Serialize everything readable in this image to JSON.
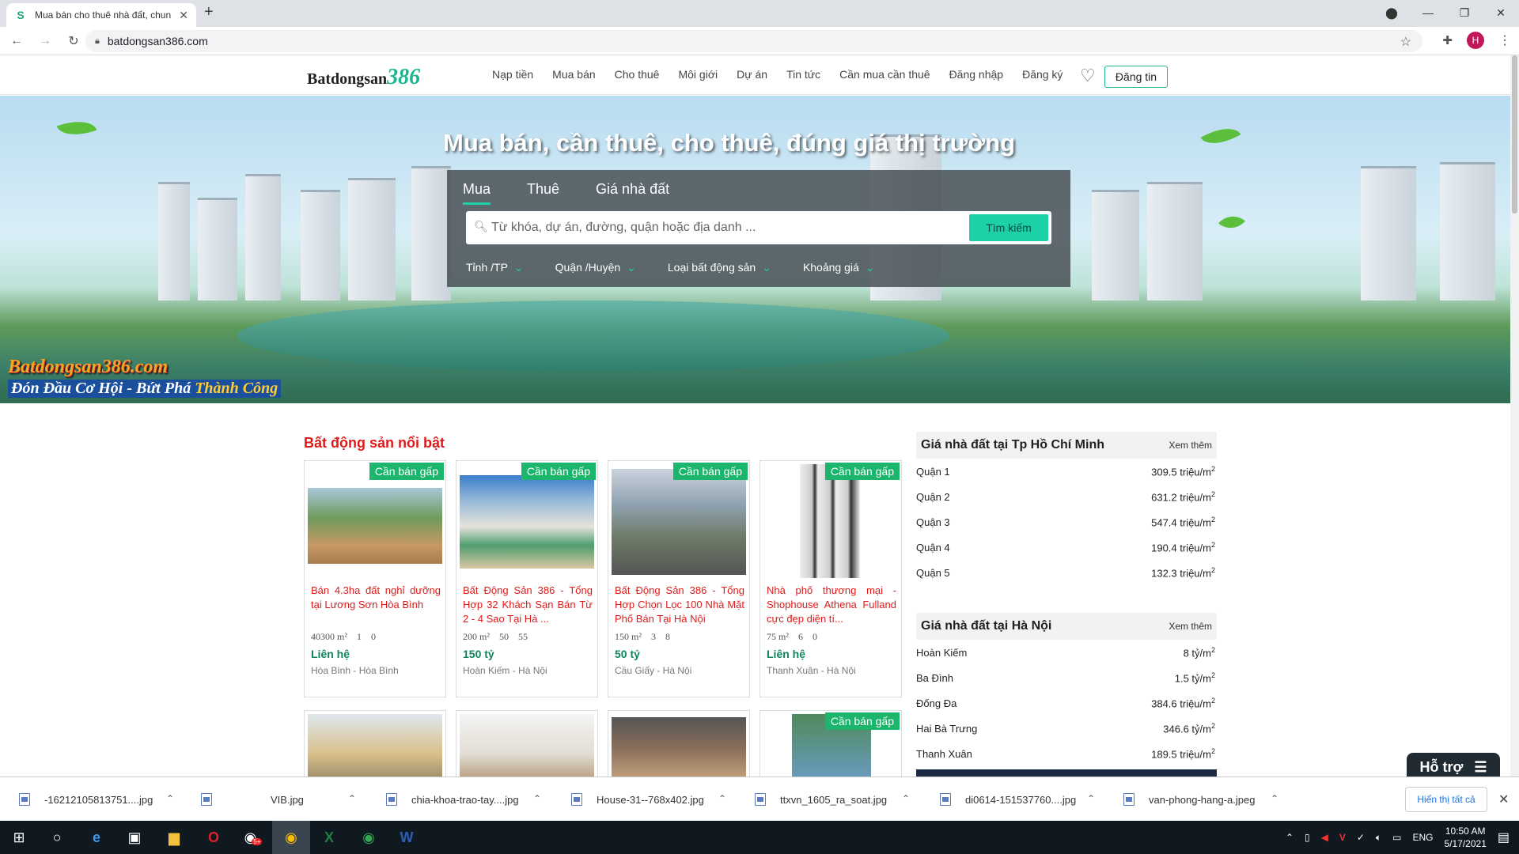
{
  "browser": {
    "tab_title": "Mua bán cho thuê nhà đất, chun",
    "url": "batdongsan386.com",
    "avatar_letter": "H"
  },
  "header": {
    "logo_text": "Batdongsan",
    "logo_num": "386",
    "menu": [
      "Nạp tiền",
      "Mua bán",
      "Cho thuê",
      "Môi giới",
      "Dự án",
      "Tin tức",
      "Cần mua cần thuê",
      "Đăng nhập",
      "Đăng ký"
    ],
    "post_button": "Đăng tin"
  },
  "hero": {
    "title": "Mua bán, cần thuê, cho thuê, đúng giá thị trường",
    "tabs": [
      "Mua",
      "Thuê",
      "Giá nhà đất"
    ],
    "active_tab": "Mua",
    "search_placeholder": "Từ khóa, dự án, đường, quận hoặc địa danh ...",
    "search_button": "Tìm kiếm",
    "filters": [
      "Tỉnh /TP",
      "Quận /Huyện",
      "Loại bất động sản",
      "Khoảng giá"
    ],
    "brand_line1": "Batdongsan386.com",
    "brand_line2a": "Đón Đầu Cơ Hội - Bứt Phá ",
    "brand_line2b": "Thành Công"
  },
  "featured": {
    "title": "Bất động sản nổi bật",
    "badge": "Cần bán gấp",
    "cards": [
      {
        "title": "Bán 4.3ha đất nghỉ dưỡng tại Lương Sơn Hòa Bình",
        "area": "40300 m²",
        "beds": "1",
        "baths": "0",
        "price": "Liên hệ",
        "location": "Hòa Bình - Hòa Bình"
      },
      {
        "title": "Bất Động Sản 386 - Tổng Hợp 32 Khách Sạn Bán Từ 2 - 4 Sao Tại Hà ...",
        "area": "200 m²",
        "beds": "50",
        "baths": "55",
        "price": "150 tỷ",
        "location": "Hoàn Kiếm - Hà Nội"
      },
      {
        "title": "Bất Động Sản 386 - Tổng Hợp Chọn Lọc 100 Nhà Mặt Phố Bán Tại Hà Nội",
        "area": "150 m²",
        "beds": "3",
        "baths": "8",
        "price": "50 tỷ",
        "location": "Cầu Giấy - Hà Nội"
      },
      {
        "title": "Nhà phố thương mại - Shophouse Athena Fulland cực đẹp diện tí...",
        "area": "75 m²",
        "beds": "6",
        "baths": "0",
        "price": "Liên hệ",
        "location": "Thanh Xuân - Hà Nội"
      }
    ]
  },
  "prices_hcm": {
    "title": "Giá nhà đất tại Tp Hồ Chí Minh",
    "more": "Xem thêm",
    "rows": [
      {
        "name": "Quận 1",
        "value": "309.5 triệu/m",
        "sup": "2"
      },
      {
        "name": "Quận 2",
        "value": "631.2 triệu/m",
        "sup": "2"
      },
      {
        "name": "Quận 3",
        "value": "547.4 triệu/m",
        "sup": "2"
      },
      {
        "name": "Quận 4",
        "value": "190.4 triệu/m",
        "sup": "2"
      },
      {
        "name": "Quận 5",
        "value": "132.3 triệu/m",
        "sup": "2"
      }
    ]
  },
  "prices_hn": {
    "title": "Giá nhà đất tại Hà Nội",
    "more": "Xem thêm",
    "rows": [
      {
        "name": "Hoàn Kiếm",
        "value": "8 tỷ/m",
        "sup": "2"
      },
      {
        "name": "Ba Đình",
        "value": "1.5 tỷ/m",
        "sup": "2"
      },
      {
        "name": "Đống Đa",
        "value": "384.6 triệu/m",
        "sup": "2"
      },
      {
        "name": "Hai Bà Trưng",
        "value": "346.6 tỷ/m",
        "sup": "2"
      },
      {
        "name": "Thanh Xuân",
        "value": "189.5 triệu/m",
        "sup": "2"
      }
    ]
  },
  "support": {
    "label": "Hỗ trợ"
  },
  "downloads": {
    "files": [
      "-16212105813751....jpg",
      "VIB.jpg",
      "chia-khoa-trao-tay....jpg",
      "House-31--768x402.jpg",
      "ttxvn_1605_ra_soat.jpg",
      "di0614-151537760....jpg",
      "van-phong-hang-a.jpeg"
    ],
    "show_all": "Hiển thị tất cả"
  },
  "taskbar": {
    "lang": "ENG",
    "time": "10:50 AM",
    "date": "5/17/2021",
    "badge": "5+"
  },
  "colors": {
    "accent": "#1bb58f",
    "red": "#e01a1a",
    "price_green": "#11845a"
  }
}
